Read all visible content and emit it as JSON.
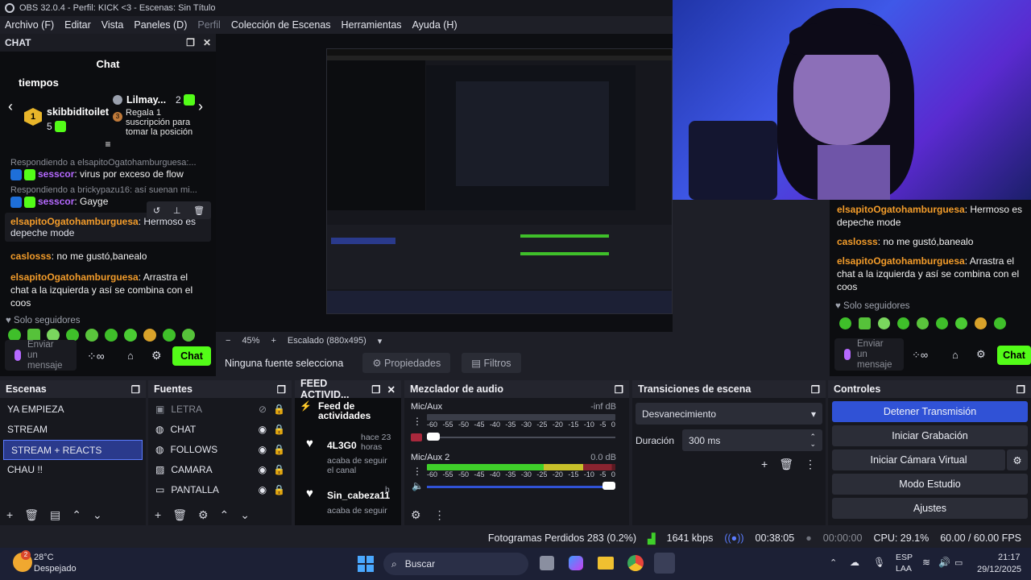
{
  "window": {
    "title": "OBS 32.0.4 - Perfil: KICK <3 - Escenas: Sin Título",
    "menu": [
      "Archivo (F)",
      "Editar",
      "Vista",
      "Paneles (D)",
      "Perfil",
      "Colección de Escenas",
      "Herramientas",
      "Ayuda (H)"
    ]
  },
  "chat_dock": {
    "label": "CHAT",
    "title": "Chat",
    "leaderboard_title": "tiempos",
    "leader1_name": "skibbiditoilet",
    "leader1_count": "5",
    "leader2_name": "Lilmay...",
    "leader2_count": "2",
    "leader3_text": "Regala 1 suscripción para tomar la posición",
    "leader3_rank": "3",
    "messages": [
      {
        "reply": "Respondiendo a elsapitoOgatohamburguesa:...",
        "nick": "sesscor",
        "text": ": virus por exceso de flow"
      },
      {
        "reply": "Respondiendo a brickypazu16: así suenan mi...",
        "nick": "sesscor",
        "text": ": Gayge"
      },
      {
        "nick": "elsapitoOgatohamburguesa",
        "text": ": Hermoso es depeche mode"
      },
      {
        "nick": "caslosss",
        "text": ": no me gustó,banealo"
      },
      {
        "nick": "elsapitoOgatohamburguesa",
        "text": ": Arrastra el chat a la izquierda y así se combina con el coos"
      }
    ],
    "followers_only": "Solo seguidores",
    "send_placeholder": "Enviar un mensaje",
    "chat_button": "Chat"
  },
  "right_chat": {
    "messages": [
      {
        "nick": "elsapitoOgatohamburguesa",
        "text": ": Hermoso es depeche mode"
      },
      {
        "nick": "caslosss",
        "text": ": no me gustó,banealo"
      },
      {
        "nick": "elsapitoOgatohamburguesa",
        "text": ": Arrastra el chat a la izquierda y así se combina con el coos"
      }
    ],
    "followers_only": "Solo seguidores",
    "send_placeholder": "Enviar un mensaje",
    "chat_button": "Chat"
  },
  "preview_bar": {
    "zoom": "45%",
    "scale": "Escalado (880x495)"
  },
  "source_bar": {
    "no_source": "Ninguna fuente selecciona",
    "properties": "Propiedades",
    "filters": "Filtros"
  },
  "scenes": {
    "title": "Escenas",
    "items": [
      "YA EMPIEZA",
      "STREAM",
      "STREAM + REACTS",
      "CHAU !!"
    ],
    "selected": "STREAM + REACTS"
  },
  "sources": {
    "title": "Fuentes",
    "items": [
      "LETRA",
      "CHAT",
      "FOLLOWS",
      "CAMARA",
      "PANTALLA"
    ]
  },
  "feed": {
    "title": "FEED ACTIVID...",
    "subtitle": "Feed de actividades",
    "entries": [
      {
        "name": "4L3G0",
        "time": "hace 23 horas",
        "action": "acaba de seguir el canal"
      },
      {
        "name": "Sin_cabeza11",
        "time": "h",
        "action": "acaba de seguir"
      }
    ]
  },
  "mixer": {
    "title": "Mezclador de audio",
    "channels": [
      {
        "name": "Mic/Aux",
        "level": "-inf dB",
        "fader": 0.05
      },
      {
        "name": "Mic/Aux 2",
        "level": "0.0 dB",
        "fader": 1.0
      }
    ],
    "ticks": [
      "-60",
      "-55",
      "-50",
      "-45",
      "-40",
      "-35",
      "-30",
      "-25",
      "-20",
      "-15",
      "-10",
      "-5",
      "0"
    ]
  },
  "transitions": {
    "title": "Transiciones de escena",
    "selected": "Desvanecimiento",
    "duration_label": "Duración",
    "duration_value": "300 ms"
  },
  "controls": {
    "title": "Controles",
    "buttons": [
      "Detener Transmisión",
      "Iniciar Grabación",
      "Iniciar Cámara Virtual",
      "Modo Estudio",
      "Ajustes"
    ]
  },
  "status": {
    "dropped": "Fotogramas Perdidos 283 (0.2%)",
    "bitrate": "1641 kbps",
    "stream_time": "00:38:05",
    "rec_time": "00:00:00",
    "cpu": "CPU: 29.1%",
    "fps": "60.00 / 60.00 FPS"
  },
  "taskbar": {
    "weather_temp": "28°C",
    "weather_desc": "Despejado",
    "weather_badge": "2",
    "search": "Buscar",
    "lang1": "ESP",
    "lang2": "LAA",
    "time": "21:17",
    "date": "29/12/2025"
  },
  "colors": {
    "accent": "#3052d6",
    "kick_green": "#53fc18",
    "nick_orange": "#f39c2a",
    "nick_purple": "#b569ff"
  }
}
